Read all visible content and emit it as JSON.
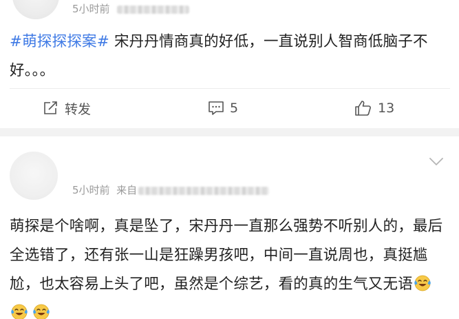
{
  "post1": {
    "time": "5小时前",
    "topic": "#萌探探探案#",
    "text": " 宋丹丹情商真的好低，一直说别人智商低脑子不好。。。",
    "actions": {
      "repost_label": "转发",
      "comment_count": "5",
      "like_count": "13"
    }
  },
  "post2": {
    "time": "5小时前",
    "source_prefix": "来自",
    "text": "萌探是个啥啊，真是坠了，宋丹丹一直那么强势不听别人的，最后全选错了，还有张一山是狂躁男孩吧，中间一直说周也，真挺尴尬，也太容易上头了吧，虽然是个综艺，看的真的生气又无语",
    "emojis": [
      "laugh-cry-emoji",
      "laugh-cry-emoji",
      "laugh-cry-emoji"
    ]
  },
  "colors": {
    "topic": "#3f7ae5",
    "text": "#222222",
    "meta": "#9a9a9a",
    "separator": "#f2f2f2"
  }
}
